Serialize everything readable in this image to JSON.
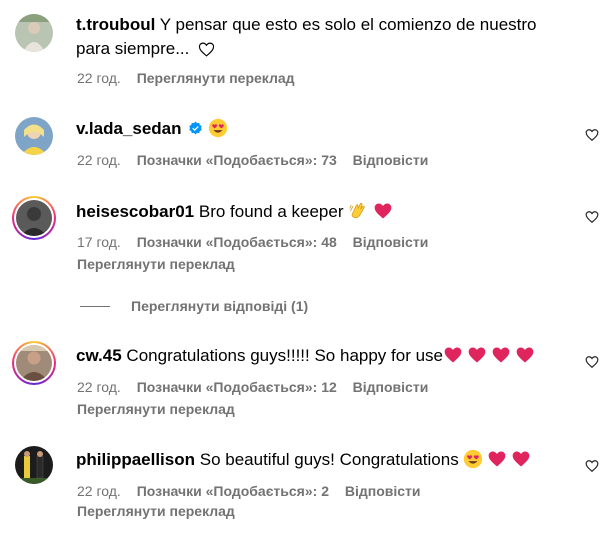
{
  "comments": [
    {
      "username": "t.trouboul",
      "text_line1": "Y pensar que esto es solo el comienzo de nuestro",
      "text_line2": "para siempre...",
      "time": "22 год.",
      "translate_label": "Переглянути переклад"
    },
    {
      "username": "v.lada_sedan",
      "time": "22 год.",
      "likes_label": "Позначки «Подобається»: 73",
      "reply_label": "Відповісти"
    },
    {
      "username": "heisescobar01",
      "text": "Bro found a keeper",
      "time": "17 год.",
      "likes_label": "Позначки «Подобається»: 48",
      "reply_label": "Відповісти",
      "translate_label": "Переглянути переклад",
      "view_replies_label": "Переглянути відповіді (1)"
    },
    {
      "username": "cw.45",
      "text": "Congratulations guys!!!!! So happy for use",
      "time": "22 год.",
      "likes_label": "Позначки «Подобається»: 12",
      "reply_label": "Відповісти",
      "translate_label": "Переглянути переклад"
    },
    {
      "username": "philippaellison",
      "text": "So beautiful guys! Congratulations",
      "time": "22 год.",
      "likes_label": "Позначки «Подобається»: 2",
      "reply_label": "Відповісти",
      "translate_label": "Переглянути переклад"
    }
  ],
  "icons": {
    "like": "heart-outline-icon",
    "verified": "verified-badge-icon",
    "emoji_heart_eyes": "heart-eyes-emoji",
    "emoji_clap": "clapping-hands-emoji",
    "emoji_heart": "red-heart-emoji"
  },
  "colors": {
    "meta_text": "#737373",
    "verified_blue": "#0095f6",
    "heart_red": "#e0245e",
    "ring_gradient": [
      "#f9ce34",
      "#ee2a7b",
      "#6228d7"
    ]
  }
}
